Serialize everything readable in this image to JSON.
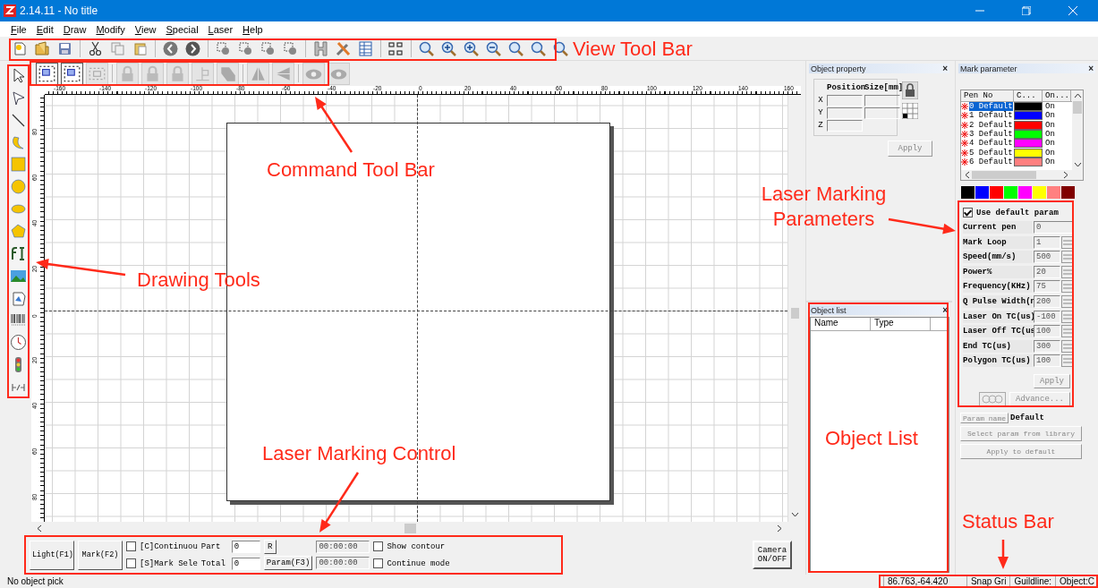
{
  "window": {
    "title": "2.14.11 - No title"
  },
  "menu": [
    {
      "label": "File"
    },
    {
      "label": "Edit"
    },
    {
      "label": "Draw"
    },
    {
      "label": "Modify"
    },
    {
      "label": "View"
    },
    {
      "label": "Special"
    },
    {
      "label": "Laser"
    },
    {
      "label": "Help"
    }
  ],
  "ruler": {
    "top_labels": [
      "-160",
      "-140",
      "-120",
      "-100",
      "-80",
      "-60",
      "-40",
      "-20",
      "0",
      "20",
      "40",
      "60",
      "80",
      "100",
      "120",
      "140",
      "160"
    ],
    "left_labels": [
      "80",
      "60",
      "40",
      "20",
      "0",
      "20",
      "40",
      "60",
      "80"
    ]
  },
  "object_property": {
    "title": "Object property",
    "close": "×",
    "headers": [
      "Position",
      "Size[mm]"
    ],
    "axes": [
      {
        "label": "X"
      },
      {
        "label": "Y"
      },
      {
        "label": "Z"
      }
    ],
    "apply": {
      "label": "Apply",
      "disabled": true
    }
  },
  "object_list": {
    "title": "Object list",
    "close": "×",
    "columns": [
      "Name",
      "Type"
    ]
  },
  "mark_parameter": {
    "title": "Mark parameter",
    "close": "×",
    "pen_columns": [
      "Pen No",
      "C...",
      "On..."
    ],
    "pens": [
      {
        "name": "0 Default",
        "color": "#000000",
        "state": "On",
        "selected": true
      },
      {
        "name": "1 Default",
        "color": "#0000ff",
        "state": "On",
        "selected": false
      },
      {
        "name": "2 Default",
        "color": "#ff0000",
        "state": "On",
        "selected": false
      },
      {
        "name": "3 Default",
        "color": "#00ff00",
        "state": "On",
        "selected": false
      },
      {
        "name": "4 Default",
        "color": "#ff00ff",
        "state": "On",
        "selected": false
      },
      {
        "name": "5 Default",
        "color": "#ffff00",
        "state": "On",
        "selected": false
      },
      {
        "name": "6 Default",
        "color": "#ff8080",
        "state": "On",
        "selected": false
      }
    ],
    "swatches": [
      {
        "color": "#000000"
      },
      {
        "color": "#0000ff"
      },
      {
        "color": "#ff0000"
      },
      {
        "color": "#00ff00"
      },
      {
        "color": "#ff00ff"
      },
      {
        "color": "#ffff00"
      },
      {
        "color": "#ff8080"
      },
      {
        "color": "#800000"
      }
    ],
    "use_default": {
      "label": "Use default param",
      "checked": true
    },
    "params": [
      {
        "label": "Current pen",
        "value": "0",
        "kind": "plain"
      },
      {
        "label": "Mark Loop",
        "value": "1",
        "kind": "spin"
      },
      {
        "label": "Speed(mm/s)",
        "value": "500",
        "kind": "spin"
      },
      {
        "label": "Power%",
        "value": "20",
        "kind": "spin"
      },
      {
        "label": "Frequency(KHz)",
        "value": "75",
        "kind": "spin"
      },
      {
        "label": "Q Pulse Width(n",
        "value": "200",
        "kind": "spin"
      },
      {
        "label": "Laser On TC(us)",
        "value": "-100",
        "kind": "spin"
      },
      {
        "label": "Laser Off TC(us",
        "value": "100",
        "kind": "spin"
      },
      {
        "label": "End TC(us)",
        "value": "300",
        "kind": "spin"
      },
      {
        "label": "Polygon TC(us)",
        "value": "100",
        "kind": "spin"
      }
    ],
    "apply": {
      "label": "Apply",
      "disabled": true
    },
    "advance": {
      "label": "Advance...",
      "disabled": true
    },
    "param_name": {
      "label": "Param name",
      "value": "Default"
    },
    "select_library": {
      "label": "Select param from library",
      "disabled": true
    },
    "apply_default": {
      "label": "Apply to default",
      "disabled": true
    }
  },
  "control": {
    "light": "Light(F1)",
    "mark": "Mark(F2)",
    "checks": [
      {
        "label": "[C]Continuou",
        "checked": false
      },
      {
        "label": "[S]Mark Sele",
        "checked": false
      }
    ],
    "counters": [
      {
        "label": "Part",
        "value": "0"
      },
      {
        "label": "Total",
        "value": "0"
      }
    ],
    "reset": "R",
    "param": "Param(F3)",
    "times": [
      "00:00:00",
      "00:00:00"
    ],
    "options": [
      {
        "label": "Show contour",
        "checked": false
      },
      {
        "label": "Continue mode",
        "checked": false
      }
    ],
    "camera": "Camera ON/OFF"
  },
  "status_bar": {
    "message": "No object pick",
    "cells": [
      "86.763,-64.420",
      "Snap Gri",
      "Guildline:",
      "Object:C"
    ]
  },
  "annotations": [
    {
      "text": "View Tool Bar"
    },
    {
      "text": "Command Tool Bar"
    },
    {
      "text": "Drawing Tools"
    },
    {
      "text": "Laser Marking Control"
    },
    {
      "text": "Laser Marking Parameters"
    },
    {
      "text": "Object List"
    },
    {
      "text": "Status Bar"
    }
  ]
}
